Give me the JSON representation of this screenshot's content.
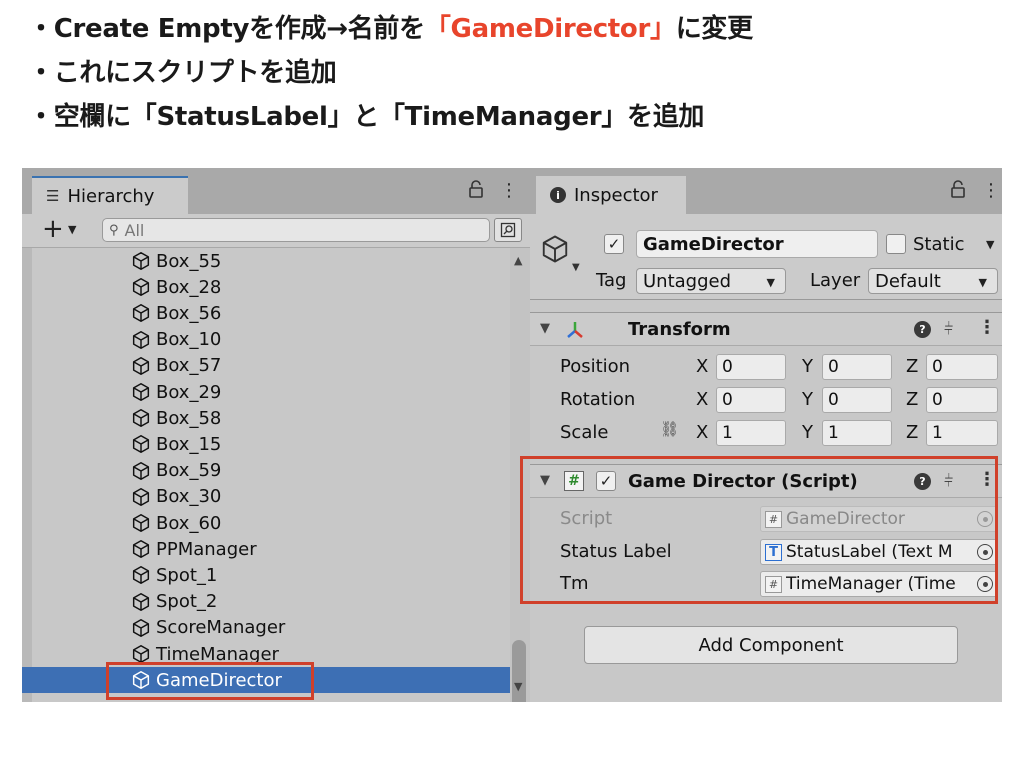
{
  "instructions": {
    "line1_prefix": "・Create Emptyを作成→名前を",
    "line1_highlight": "「GameDirector」",
    "line1_suffix": "に変更",
    "line2": "・これにスクリプトを追加",
    "line3": "・空欄に「StatusLabel」と「TimeManager」を追加",
    "highlight_color": "#e8452c"
  },
  "hierarchy": {
    "tab_label": "Hierarchy",
    "search_placeholder": "All",
    "items": [
      "Box_55",
      "Box_28",
      "Box_56",
      "Box_10",
      "Box_57",
      "Box_29",
      "Box_58",
      "Box_15",
      "Box_59",
      "Box_30",
      "Box_60",
      "PPManager",
      "Spot_1",
      "Spot_2",
      "ScoreManager",
      "TimeManager",
      "GameDirector"
    ],
    "selected_item": "GameDirector",
    "selection_color": "#3d6fb4"
  },
  "inspector": {
    "tab_label": "Inspector",
    "object_name": "GameDirector",
    "static_label": "Static",
    "tag_label": "Tag",
    "tag_value": "Untagged",
    "layer_label": "Layer",
    "layer_value": "Default",
    "transform": {
      "title": "Transform",
      "rows": [
        {
          "label": "Position",
          "x": "0",
          "y": "0",
          "z": "0"
        },
        {
          "label": "Rotation",
          "x": "0",
          "y": "0",
          "z": "0"
        },
        {
          "label": "Scale",
          "x": "1",
          "y": "1",
          "z": "1"
        }
      ],
      "axes": [
        "X",
        "Y",
        "Z"
      ]
    },
    "script_component": {
      "title": "Game Director (Script)",
      "fields": [
        {
          "label": "Script",
          "value": "GameDirector",
          "disabled": true
        },
        {
          "label": "Status Label",
          "value": "StatusLabel (Text M"
        },
        {
          "label": "Tm",
          "value": "TimeManager (Time"
        }
      ]
    },
    "add_component_label": "Add Component"
  },
  "icons": {
    "tab_menu": "hamburger-icon",
    "lock": "lock-icon",
    "more": "kebab-icon",
    "gameobject": "cube-icon",
    "script": "hash-icon",
    "text": "text-t-icon",
    "help": "help-icon",
    "presets": "sliders-icon",
    "constrain": "link-icon"
  },
  "annotation_color": "#d0402a"
}
